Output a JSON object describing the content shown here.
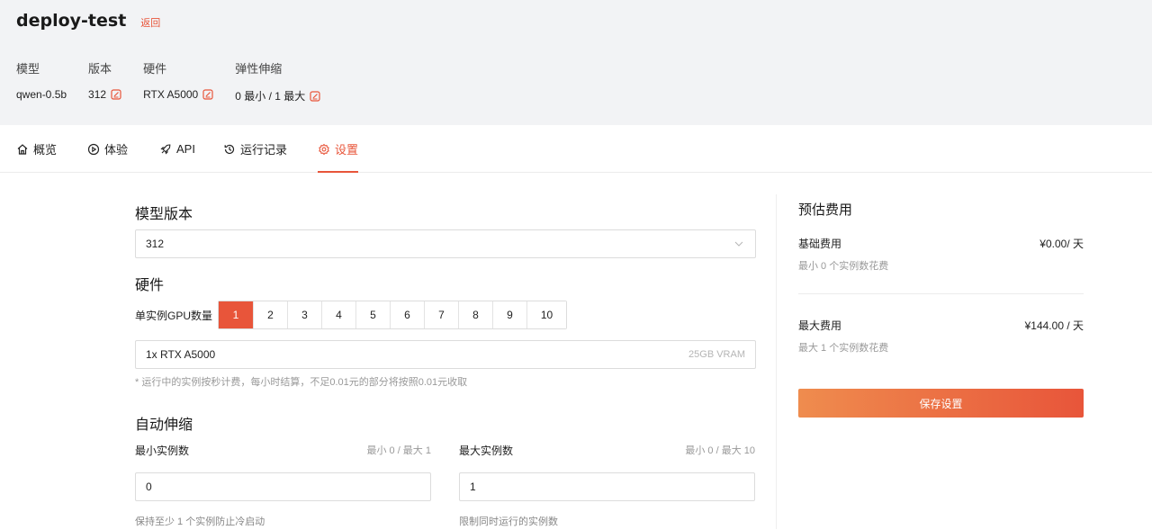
{
  "header": {
    "title": "deploy-test",
    "back_label": "返回",
    "meta": [
      {
        "label": "模型",
        "value": "qwen-0.5b",
        "editable": false
      },
      {
        "label": "版本",
        "value": "312",
        "editable": true
      },
      {
        "label": "硬件",
        "value": "RTX A5000",
        "editable": true
      },
      {
        "label": "弹性伸缩",
        "value": "0 最小 / 1 最大",
        "editable": true
      }
    ]
  },
  "tabs": [
    {
      "label": "概览",
      "icon": "home-icon"
    },
    {
      "label": "体验",
      "icon": "play-circle-icon"
    },
    {
      "label": "API",
      "icon": "rocket-icon"
    },
    {
      "label": "运行记录",
      "icon": "history-icon"
    },
    {
      "label": "设置",
      "icon": "gear-icon",
      "active": true
    }
  ],
  "settings": {
    "version_title": "模型版本",
    "version_value": "312",
    "hardware_title": "硬件",
    "gpu_label": "单实例GPU数量",
    "gpu_options": [
      "1",
      "2",
      "3",
      "4",
      "5",
      "6",
      "7",
      "8",
      "9",
      "10"
    ],
    "gpu_selected": "1",
    "hardware_value": "1x RTX A5000",
    "hardware_vram": "25GB VRAM",
    "billing_note": "* 运行中的实例按秒计费，每小时结算，不足0.01元的部分将按照0.01元收取",
    "autoscale_title": "自动伸缩",
    "min_label": "最小实例数",
    "min_range": "最小 0 / 最大 1",
    "min_value": "0",
    "min_hint": "保持至少 1 个实例防止冷启动",
    "max_label": "最大实例数",
    "max_range": "最小 0 / 最大 10",
    "max_value": "1",
    "max_hint": "限制同时运行的实例数"
  },
  "cost": {
    "title": "预估费用",
    "base_label": "基础费用",
    "base_value": "¥0.00/ 天",
    "base_sub": "最小 0 个实例数花费",
    "max_label": "最大费用",
    "max_value": "¥144.00 / 天",
    "max_sub": "最大 1 个实例数花费",
    "save_label": "保存设置"
  },
  "colors": {
    "accent": "#e8553a",
    "header_bg": "#f2f3f5"
  }
}
